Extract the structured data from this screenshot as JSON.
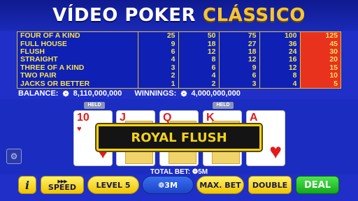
{
  "title": {
    "part1": "VÍDEO POKER",
    "part2": "CLÁSSICO"
  },
  "paytable": {
    "rows": [
      {
        "hand": "FOUR OF A KIND",
        "pays": [
          "25",
          "50",
          "75",
          "100",
          "125"
        ]
      },
      {
        "hand": "FULL HOUSE",
        "pays": [
          "9",
          "18",
          "27",
          "36",
          "45"
        ]
      },
      {
        "hand": "FLUSH",
        "pays": [
          "6",
          "12",
          "18",
          "24",
          "30"
        ]
      },
      {
        "hand": "STRAIGHT",
        "pays": [
          "4",
          "8",
          "12",
          "16",
          "20"
        ]
      },
      {
        "hand": "THREE OF A KIND",
        "pays": [
          "3",
          "6",
          "9",
          "12",
          "15"
        ]
      },
      {
        "hand": "TWO PAIR",
        "pays": [
          "2",
          "4",
          "6",
          "8",
          "10"
        ]
      },
      {
        "hand": "JACKS OR BETTER",
        "pays": [
          "1",
          "2",
          "3",
          "4",
          "5"
        ]
      }
    ],
    "highlight_column": 5
  },
  "status": {
    "balance_label": "BALANCE:",
    "balance_value": "8,110,000,000",
    "winnings_label": "WINNINGS:",
    "winnings_value": "4,000,000,000"
  },
  "held_label": "HELD",
  "cards": [
    {
      "rank": "10",
      "suit": "♥",
      "held": true
    },
    {
      "rank": "J",
      "suit": "♥",
      "held": false
    },
    {
      "rank": "Q",
      "suit": "♥",
      "held": false
    },
    {
      "rank": "K",
      "suit": "♥",
      "held": true
    },
    {
      "rank": "A",
      "suit": "♥",
      "held": false
    }
  ],
  "banner": "ROYAL FLUSH",
  "total_bet": {
    "label": "TOTAL BET:",
    "value": "5M"
  },
  "buttons": {
    "info": "i",
    "speed": "SPEED",
    "level": "LEVEL 5",
    "bet": "3M",
    "max_bet": "MAX. BET",
    "double": "DOUBLE",
    "deal": "DEAL"
  },
  "colors": {
    "background": "#1f2fc8",
    "gold": "#f6c531",
    "highlight": "#e8321e",
    "deal_green": "#14a81a"
  }
}
